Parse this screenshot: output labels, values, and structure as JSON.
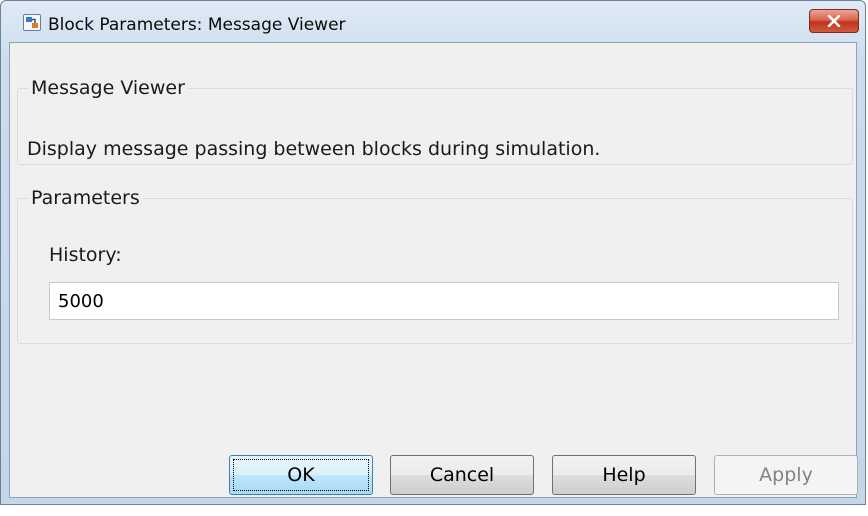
{
  "window": {
    "title": "Block Parameters: Message Viewer",
    "icon": "simulink-block-icon",
    "close_icon": "close-icon",
    "close_color": "#c7432b"
  },
  "description_group": {
    "title": "Message Viewer",
    "text": "Display message passing between blocks during simulation."
  },
  "parameters_group": {
    "title": "Parameters",
    "history_label": "History:",
    "history_value": "5000"
  },
  "buttons": {
    "ok": "OK",
    "cancel": "Cancel",
    "help": "Help",
    "apply": "Apply"
  }
}
